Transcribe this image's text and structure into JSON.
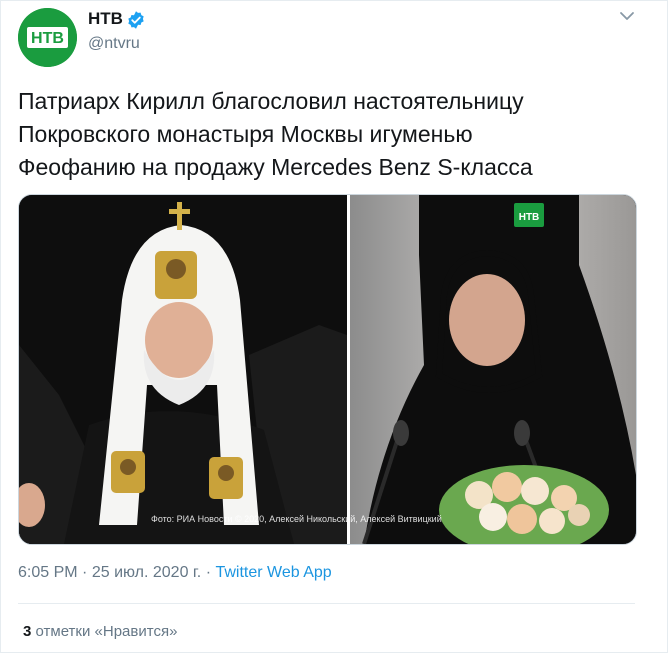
{
  "account": {
    "name": "НТВ",
    "handle": "@ntvru",
    "logo_text": "НТВ",
    "brand_color": "#1a9c3f",
    "verified_color": "#1da1f2"
  },
  "tweet": {
    "lines": [
      "Патриарх Кирилл благословил настоятельницу",
      "Покровского монастыря Москвы игуменью",
      "Феофанию на продажу Mercedes Benz S-класса"
    ]
  },
  "media": {
    "logo_text": "НТВ",
    "caption": "Фото: РИА Новости © 2020, Алексей Никольский, Алексей Витвицкий"
  },
  "meta": {
    "time": "6:05 PM",
    "dot1": "·",
    "date": "25 июл. 2020 г.",
    "dot2": "·",
    "app": "Twitter Web App"
  },
  "stats": {
    "likes_count": "3",
    "likes_label": "отметки «Нравится»"
  },
  "icons": {
    "menu": "chevron-down-icon",
    "verified": "verified-badge-icon"
  }
}
